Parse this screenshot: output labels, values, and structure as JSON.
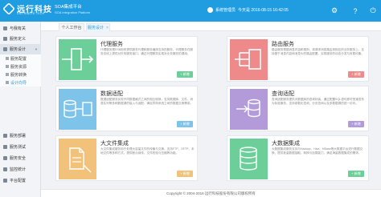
{
  "header": {
    "logo_name": "远行科技",
    "logo_sub": "DISTRIBUTE TECH",
    "title": "SOA集成平台",
    "subtitle": "SOA Integration Platform",
    "user": "系统管理员",
    "date_text": "今天是 2016-08-15 16:42:05",
    "colors": {
      "header_bg": "#1f9de0"
    }
  },
  "sidebar": {
    "items": [
      {
        "label": "与我有关",
        "icon": "star-icon"
      },
      {
        "label": "服务定义",
        "icon": "doc-icon"
      },
      {
        "label": "服务设计",
        "icon": "design-icon"
      },
      {
        "label": "服务部署",
        "icon": "deploy-icon"
      },
      {
        "label": "服务测试",
        "icon": "test-icon"
      },
      {
        "label": "服务安全",
        "icon": "lock-icon"
      },
      {
        "label": "监控统计",
        "icon": "chart-icon"
      },
      {
        "label": "平台配置",
        "icon": "gear-icon"
      }
    ],
    "sub_items": [
      {
        "label": "服务配置"
      },
      {
        "label": "服务资源"
      },
      {
        "label": "服务转换"
      },
      {
        "label": "设计向导"
      }
    ]
  },
  "tabs": [
    {
      "label": "个人工作台"
    },
    {
      "label": "服务设计",
      "close": "×"
    }
  ],
  "cards": [
    {
      "title": "代理服务",
      "desc": "代理服务是ESB用来提供服务代理和服务编排支持的服务，代理服务在服务总线上提供对外的服务接口，通过代理服务实现对业务服务的调用。",
      "button": "+ 新增",
      "color": "#6ccf9a"
    },
    {
      "title": "路由服务",
      "desc": "路由服务根据消息内容和规则，将请求消息路由到相应的业务服务上，支持基于消息内容和消息头的路由配置，实现服务的动态分发与负载均衡。",
      "button": "+ 新增",
      "color": "#ef8a8a"
    },
    {
      "title": "数据适配",
      "desc": "数据适配服务实现不同数据格式之间的相互转换，支持数据库、文件、消息队列等多种数据源的接入与适配，满足异构系统之间的数据交换需求。",
      "button": "+ 新增",
      "color": "#7ec3ea"
    },
    {
      "title": "查询适配",
      "desc": "查询适配服务提供对数据库的查询封装，通过配置SQL语句即可快速发布为标准服务，支持参数化查询、分页查询以及多数据源的统一访问。",
      "button": "+ 新增",
      "color": "#b39ad9"
    },
    {
      "title": "大文件集成",
      "desc": "大文件集成服务用于处理大容量文件的传输与交换，支持FTP、SFTP、本地文件等多种方式，提供断点续传、文件校验与压缩等功能。",
      "button": "+ 新增",
      "color": "#f2c27a"
    },
    {
      "title": "大数据集成",
      "desc": "大数据集成服务支持与Hadoop、Hive、HBase等大数据平台进行数据交换，提供批量数据抽取、转换与加载能力，满足海量数据集成的需求。",
      "button": "+ 新增",
      "color": "#6ccf9a"
    }
  ],
  "footer": {
    "text": "Copyright © 2004-2016 远行科技股份有限公司版权所有"
  }
}
